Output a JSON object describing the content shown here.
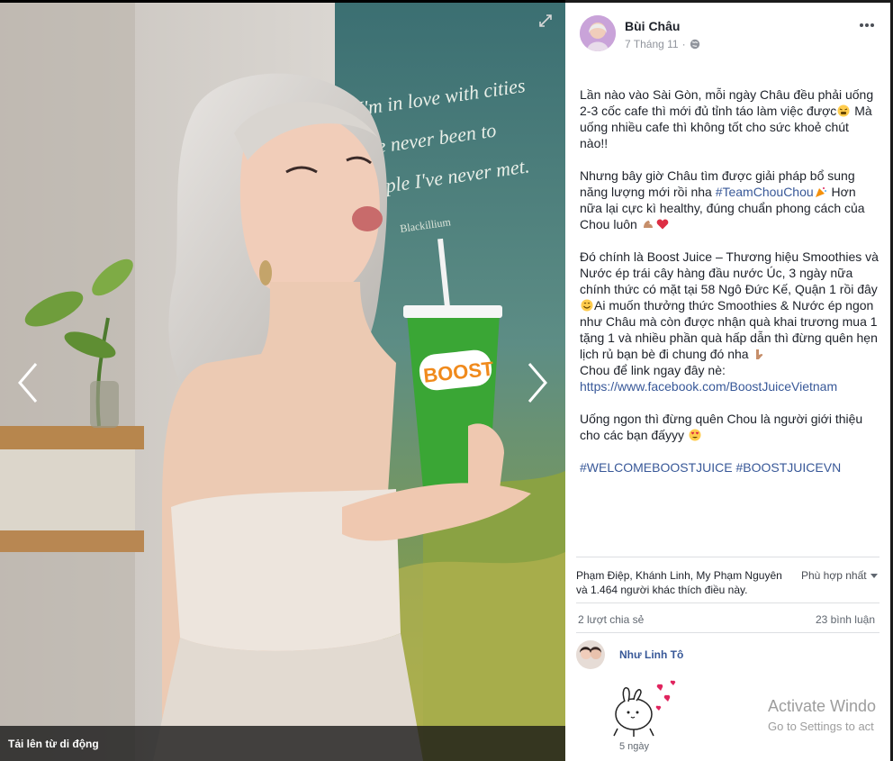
{
  "photo": {
    "cup_brand": "BOOST",
    "poster_lines": [
      "I'm in love with cities",
      "I've never been to",
      "people I've never met."
    ],
    "poster_signature": "Blackillium",
    "upload_label": "Tải lên từ di động"
  },
  "post": {
    "author": "Bùi Châu",
    "date": "7 Tháng 11",
    "separator": "·",
    "paragraphs": {
      "p1": "Lần nào vào Sài Gòn, mỗi ngày Châu đều phải uống 2-3 cốc cafe thì mới đủ tỉnh táo làm việc được",
      "p1_end": " Mà uống nhiều cafe thì không tốt cho sức khoẻ chút nào!!",
      "p2_start": "Nhưng bây giờ Châu tìm được giải pháp bổ sung năng lượng mới rồi nha ",
      "p2_tag": "#TeamChouChou",
      "p2_mid": " Hơn nữa lại cực kì healthy, đúng chuẩn phong cách của Chou luôn ",
      "p3_a": "Đó chính là Boost Juice – Thương hiệu Smoothies và Nước ép trái cây hàng đầu nước Úc, 3 ngày nữa chính thức có mặt tại 58 Ngô Đức Kế, Quận 1 rồi đây",
      "p3_b": "Ai muốn thưởng thức Smoothies & Nước ép ngon như Châu mà còn được nhận quà khai trương mua 1 tặng 1 và nhiều phần quà hấp dẫn thì đừng quên hẹn lịch rủ bạn bè đi chung đó nha ",
      "p3_c": "Chou để link ngay đây nè:",
      "p3_link": "https://www.facebook.com/BoostJuiceVietnam",
      "p4": "Uống ngon thì đừng quên Chou là người giới thiệu cho các bạn đấyyy ",
      "tag1": "#WELCOMEBOOSTJUICE",
      "tag2": "#BOOSTJUICEVN"
    }
  },
  "reactions": {
    "likes_text": "Phạm Điệp, Khánh Linh, My Phạm Nguyên và 1.464 người khác thích điều này.",
    "sort_label": "Phù hợp nhất",
    "shares_label": "2 lượt chia sẻ",
    "comments_label": "23 bình luận"
  },
  "comment": {
    "author": "Như Linh Tô",
    "time": "5 ngày"
  },
  "watermark": {
    "line1": "Activate Windo",
    "line2": "Go to Settings to act"
  },
  "colors": {
    "link": "#385898",
    "cup_green": "#3aa635",
    "heart": "#e0245e"
  },
  "icons": [
    "expand-icon",
    "chevron-left-icon",
    "chevron-right-icon",
    "globe-icon",
    "more-icon",
    "caret-down-icon"
  ]
}
